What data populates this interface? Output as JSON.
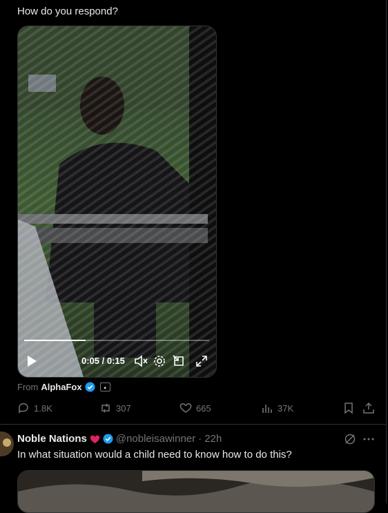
{
  "post": {
    "text": "How do you respond?",
    "video": {
      "time": "0:05 / 0:15",
      "progress": 0.333
    },
    "source": {
      "prefix": "From",
      "name": "AlphaFox"
    },
    "actions": {
      "replies": "1.8K",
      "reposts": "307",
      "likes": "665",
      "views": "37K"
    }
  },
  "reply": {
    "name": "Noble Nations",
    "handle": "@nobleisawinner",
    "time": "· 22h",
    "text": "In what situation would a child need to know how to do this?"
  },
  "colors": {
    "background": "#000000",
    "muted": "#71767b",
    "verified": "#1d9bf0",
    "heart": "#e0245e"
  }
}
